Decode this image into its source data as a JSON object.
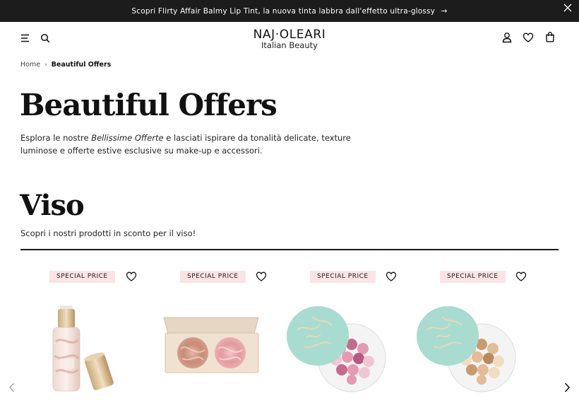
{
  "announcement": {
    "text": "Scopri Flirty Affair Balmy Lip Tint, la nuova tinta labbra dall'effetto ultra-glossy",
    "arrow": "→"
  },
  "header": {
    "brand": "NAJ·OLEARI",
    "tagline": "Italian Beauty",
    "icons": [
      "menu-icon",
      "search-icon",
      "account-icon",
      "wishlist-icon",
      "bag-icon"
    ]
  },
  "breadcrumb": {
    "home": "Home",
    "separator": "›",
    "current": "Beautiful Offers"
  },
  "page": {
    "title": "Beautiful Offers",
    "intro_before": "Esplora le nostre ",
    "intro_em": "Bellissime Offerte",
    "intro_after": " e lasciati ispirare da tonalità delicate, texture luminose e offerte estive esclusive su make-up e accessori."
  },
  "section": {
    "title": "Viso",
    "subtitle": "Scopri i nostri prodotti in sconto per il viso!"
  },
  "products": [
    {
      "badge": "SPECIAL PRICE",
      "image": "serum-bottle"
    },
    {
      "badge": "SPECIAL PRICE",
      "image": "blush-palette"
    },
    {
      "badge": "SPECIAL PRICE",
      "image": "pink-pearls"
    },
    {
      "badge": "SPECIAL PRICE",
      "image": "bronze-pearls"
    }
  ],
  "colors": {
    "announcement_bg": "#1c1c1c",
    "badge_bg": "#fbe3e6",
    "jar_lid": "#a8dcd0",
    "text": "#1a1a1a"
  }
}
